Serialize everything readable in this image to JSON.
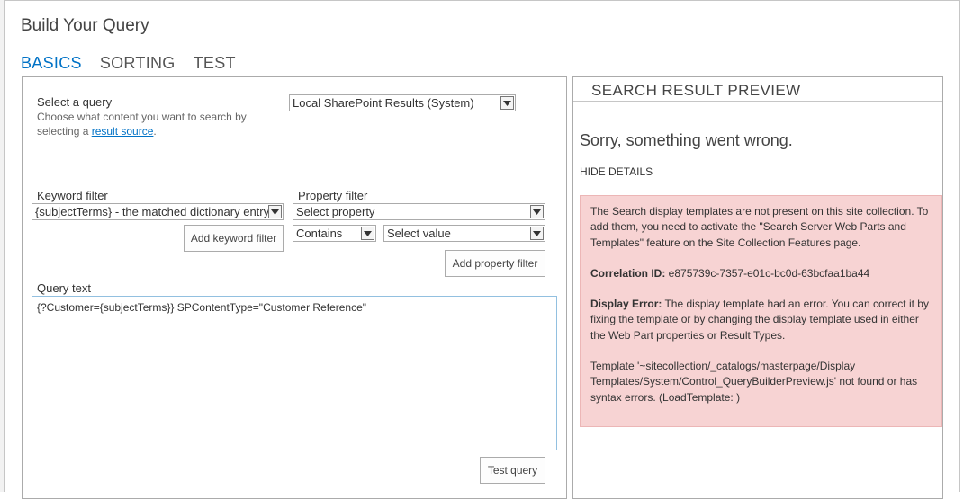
{
  "dialog": {
    "title": "Build Your Query"
  },
  "tabs": [
    {
      "label": "BASICS",
      "active": true
    },
    {
      "label": "SORTING",
      "active": false
    },
    {
      "label": "TEST",
      "active": false
    }
  ],
  "basics": {
    "select_query_label": "Select a query",
    "select_query_hint_1": "Choose what content you want to search by selecting a ",
    "select_query_hint_link": "result source",
    "select_query_hint_2": ".",
    "select_query_value": "Local SharePoint Results (System)",
    "keyword_filter_label": "Keyword filter",
    "keyword_filter_value": "{subjectTerms} - the matched dictionary entry",
    "add_keyword_filter_label": "Add keyword filter",
    "property_filter_label": "Property filter",
    "property_select_value": "Select property",
    "operator_value": "Contains",
    "value_select_value": "Select value",
    "add_property_filter_label": "Add property filter",
    "query_text_label": "Query text",
    "query_text_value": "{?Customer={subjectTerms}} SPContentType=\"Customer Reference\"",
    "test_query_label": "Test query"
  },
  "preview": {
    "title": "SEARCH RESULT PREVIEW",
    "sorry": "Sorry, something went wrong.",
    "hide_details": "HIDE DETAILS",
    "error_message": "The Search display templates are not present on this site collection. To add them, you need to activate the \"Search Server Web Parts and Templates\" feature on the Site Collection Features page.",
    "correlation_label": "Correlation ID:",
    "correlation_value": " e875739c-7357-e01c-bc0d-63bcfaa1ba44",
    "display_error_label": "Display Error:",
    "display_error_value": " The display template had an error. You can correct it by fixing the template or by changing the display template used in either the Web Part properties or Result Types.",
    "template_message": "Template '~sitecollection/_catalogs/masterpage/Display Templates/System/Control_QueryBuilderPreview.js' not found or has syntax errors. (LoadTemplate: )"
  },
  "colors": {
    "accent": "#0072c6",
    "error_background": "#f7d3d3"
  }
}
